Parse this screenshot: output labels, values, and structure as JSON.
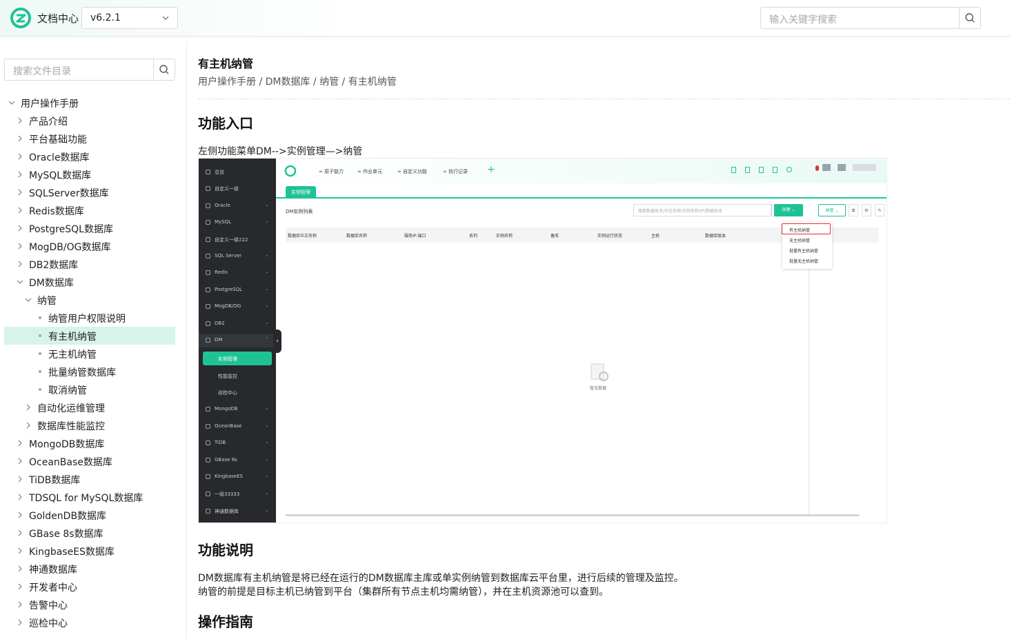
{
  "header": {
    "brand": "文档中心",
    "version": "v6.2.1",
    "search_placeholder": "输入关键字搜索"
  },
  "sidebar": {
    "search_placeholder": "搜索文件目录",
    "tree": [
      {
        "label": "用户操作手册",
        "level": 0,
        "state": "expanded"
      },
      {
        "label": "产品介绍",
        "level": 1,
        "state": "collapsed"
      },
      {
        "label": "平台基础功能",
        "level": 1,
        "state": "collapsed"
      },
      {
        "label": "Oracle数据库",
        "level": 1,
        "state": "collapsed"
      },
      {
        "label": "MySQL数据库",
        "level": 1,
        "state": "collapsed"
      },
      {
        "label": "SQLServer数据库",
        "level": 1,
        "state": "collapsed"
      },
      {
        "label": "Redis数据库",
        "level": 1,
        "state": "collapsed"
      },
      {
        "label": "PostgreSQL数据库",
        "level": 1,
        "state": "collapsed"
      },
      {
        "label": "MogDB/OG数据库",
        "level": 1,
        "state": "collapsed"
      },
      {
        "label": "DB2数据库",
        "level": 1,
        "state": "collapsed"
      },
      {
        "label": "DM数据库",
        "level": 1,
        "state": "expanded"
      },
      {
        "label": "纳管",
        "level": 2,
        "state": "expanded"
      },
      {
        "label": "纳管用户权限说明",
        "level": 3,
        "state": "leaf"
      },
      {
        "label": "有主机纳管",
        "level": 3,
        "state": "leaf",
        "active": true
      },
      {
        "label": "无主机纳管",
        "level": 3,
        "state": "leaf"
      },
      {
        "label": "批量纳管数据库",
        "level": 3,
        "state": "leaf"
      },
      {
        "label": "取消纳管",
        "level": 3,
        "state": "leaf"
      },
      {
        "label": "自动化运维管理",
        "level": 2,
        "state": "collapsed"
      },
      {
        "label": "数据库性能监控",
        "level": 2,
        "state": "collapsed"
      },
      {
        "label": "MongoDB数据库",
        "level": 1,
        "state": "collapsed"
      },
      {
        "label": "OceanBase数据库",
        "level": 1,
        "state": "collapsed"
      },
      {
        "label": "TiDB数据库",
        "level": 1,
        "state": "collapsed"
      },
      {
        "label": "TDSQL for MySQL数据库",
        "level": 1,
        "state": "collapsed"
      },
      {
        "label": "GoldenDB数据库",
        "level": 1,
        "state": "collapsed"
      },
      {
        "label": "GBase 8s数据库",
        "level": 1,
        "state": "collapsed"
      },
      {
        "label": "KingbaseES数据库",
        "level": 1,
        "state": "collapsed"
      },
      {
        "label": "神通数据库",
        "level": 1,
        "state": "collapsed"
      },
      {
        "label": "开发者中心",
        "level": 1,
        "state": "collapsed"
      },
      {
        "label": "告警中心",
        "level": 1,
        "state": "collapsed"
      },
      {
        "label": "巡检中心",
        "level": 1,
        "state": "collapsed"
      }
    ]
  },
  "content": {
    "title": "有主机纳管",
    "breadcrumb": "用户操作手册 / DM数据库 / 纳管 / 有主机纳管",
    "sec1_title": "功能入口",
    "sec1_text": "左侧功能菜单DM-->实例管理—>纳管",
    "sec2_title": "功能说明",
    "sec2_p1": "DM数据库有主机纳管是将已经在运行的DM数据库主库或单实例纳管到数据库云平台里，进行后续的管理及监控。",
    "sec2_p2": "纳管的前提是目标主机已纳管到平台（集群所有节点主机均需纳管），并在主机资源池可以查到。",
    "sec3_title": "操作指南"
  },
  "screenshot": {
    "menu": [
      {
        "label": "总览",
        "chev": false
      },
      {
        "label": "自定义一级",
        "chev": false
      },
      {
        "label": "Oracle",
        "chev": true
      },
      {
        "label": "MySQL",
        "chev": true
      },
      {
        "label": "自定义一级222",
        "chev": false
      },
      {
        "label": "SQL Server",
        "chev": true
      },
      {
        "label": "Redis",
        "chev": true
      },
      {
        "label": "PostgreSQL",
        "chev": true
      },
      {
        "label": "MogDB/OG",
        "chev": true
      },
      {
        "label": "DB2",
        "chev": true
      },
      {
        "label": "DM",
        "chev": true
      }
    ],
    "dm_sub": [
      "实例管理",
      "性能监控",
      "巡检中心"
    ],
    "menu2": [
      {
        "label": "MongoDB"
      },
      {
        "label": "OceanBase"
      },
      {
        "label": "TiDB"
      },
      {
        "label": "GBase 8s"
      },
      {
        "label": "KingbaseES"
      },
      {
        "label": "一级33333"
      },
      {
        "label": "神通数据库"
      }
    ],
    "top_tabs": [
      "原子能力",
      "作业单元",
      "自定义功能",
      "执行记录"
    ],
    "tab": "实例管理",
    "list_title": "DM实例列表",
    "search_placeholder": "搜索数据库名/中文名称/实例名称/IP/数据库池",
    "create_btn": "创建",
    "manage_btn": "纳管",
    "columns": [
      "数据库中文名称",
      "数据库名称",
      "服务IP:端口",
      "系列",
      "实例名称",
      "备库",
      "实例运行状态",
      "主机",
      "数据库版本"
    ],
    "dropdown": [
      "有主机纳管",
      "无主机纳管",
      "批量有主机纳管",
      "批量无主机纳管"
    ],
    "empty": "暂无数据"
  }
}
